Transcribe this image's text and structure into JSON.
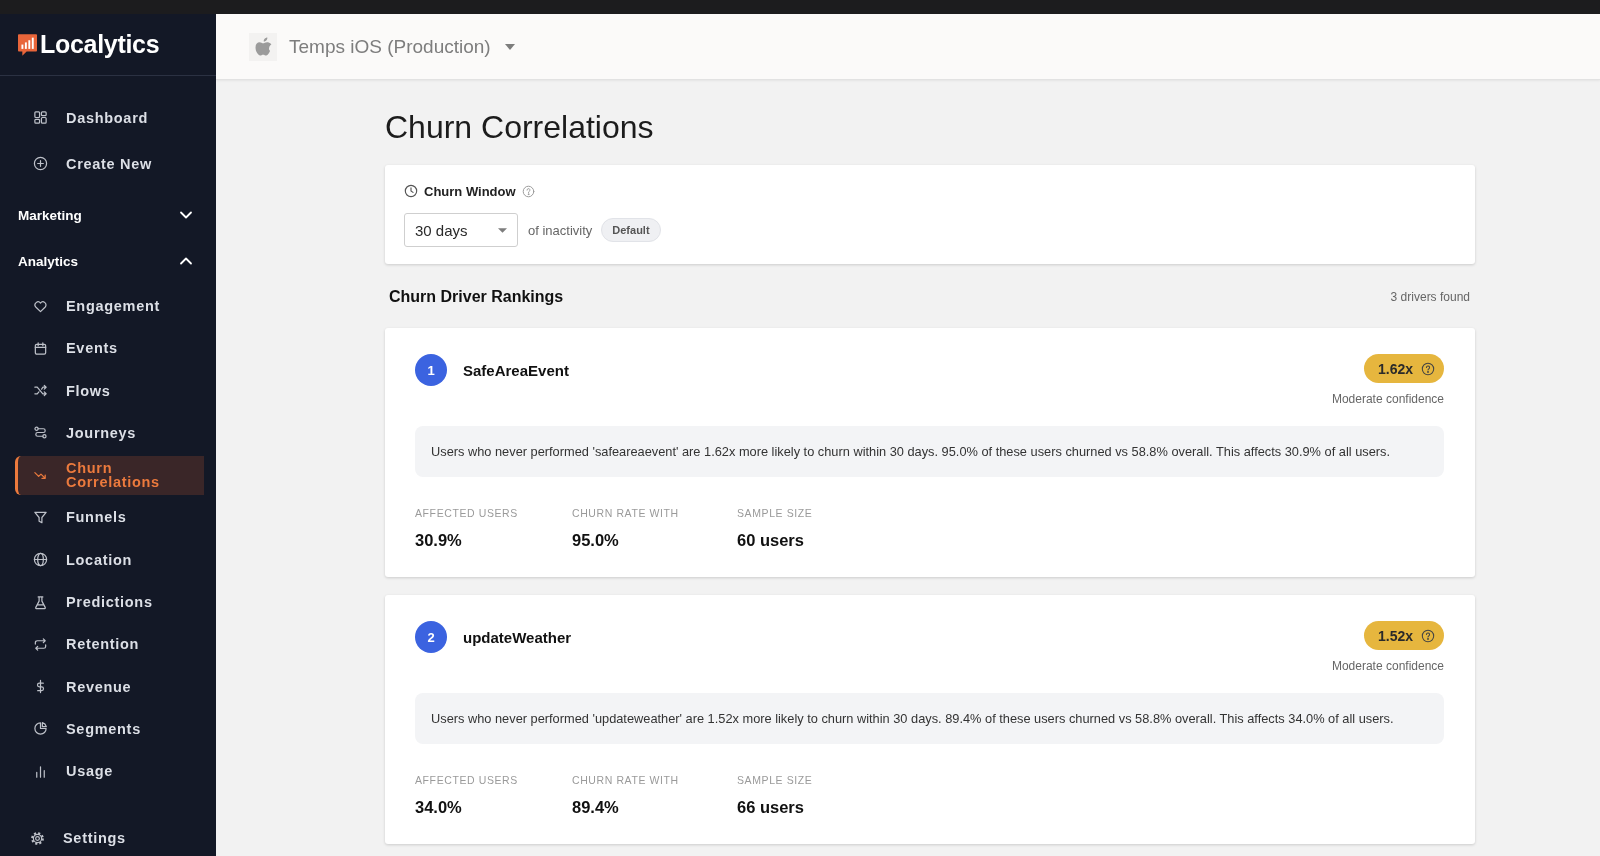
{
  "sidebar": {
    "logo": "Localytics",
    "top_items": [
      {
        "label": "Dashboard",
        "selected": false
      },
      {
        "label": "Create New",
        "selected": false
      }
    ],
    "sections": [
      {
        "title": "Marketing",
        "expanded": false
      },
      {
        "title": "Analytics",
        "expanded": true,
        "items": [
          {
            "label": "Engagement",
            "selected": false
          },
          {
            "label": "Events",
            "selected": false
          },
          {
            "label": "Flows",
            "selected": false
          },
          {
            "label": "Journeys",
            "selected": false
          },
          {
            "label": "Churn Correlations",
            "selected": true
          },
          {
            "label": "Funnels",
            "selected": false
          },
          {
            "label": "Location",
            "selected": false
          },
          {
            "label": "Predictions",
            "selected": false
          },
          {
            "label": "Retention",
            "selected": false
          },
          {
            "label": "Revenue",
            "selected": false
          },
          {
            "label": "Segments",
            "selected": false
          },
          {
            "label": "Usage",
            "selected": false
          }
        ]
      }
    ],
    "bottom_items": [
      {
        "label": "Settings",
        "selected": false
      }
    ]
  },
  "header": {
    "app_selector": "Temps iOS (Production)"
  },
  "page": {
    "title": "Churn Correlations",
    "churn_window": {
      "label": "Churn Window",
      "value": "30 days",
      "suffix": "of inactivity",
      "tag": "Default"
    },
    "rankings": {
      "title": "Churn Driver Rankings",
      "count": "3 drivers found",
      "drivers": [
        {
          "rank": "1",
          "name": "SafeAreaEvent",
          "multiplier": "1.62x",
          "confidence": "Moderate confidence",
          "description": "Users who never performed 'safeareaevent' are 1.62x more likely to churn within 30 days. 95.0% of these users churned vs 58.8% overall. This affects 30.9% of all users.",
          "stats": [
            {
              "label": "AFFECTED USERS",
              "value": "30.9%"
            },
            {
              "label": "CHURN RATE WITH",
              "value": "95.0%"
            },
            {
              "label": "SAMPLE SIZE",
              "value": "60 users"
            }
          ]
        },
        {
          "rank": "2",
          "name": "updateWeather",
          "multiplier": "1.52x",
          "confidence": "Moderate confidence",
          "description": "Users who never performed 'updateweather' are 1.52x more likely to churn within 30 days. 89.4% of these users churned vs 58.8% overall. This affects 34.0% of all users.",
          "stats": [
            {
              "label": "AFFECTED USERS",
              "value": "34.0%"
            },
            {
              "label": "CHURN RATE WITH",
              "value": "89.4%"
            },
            {
              "label": "SAMPLE SIZE",
              "value": "66 users"
            }
          ]
        }
      ]
    }
  }
}
